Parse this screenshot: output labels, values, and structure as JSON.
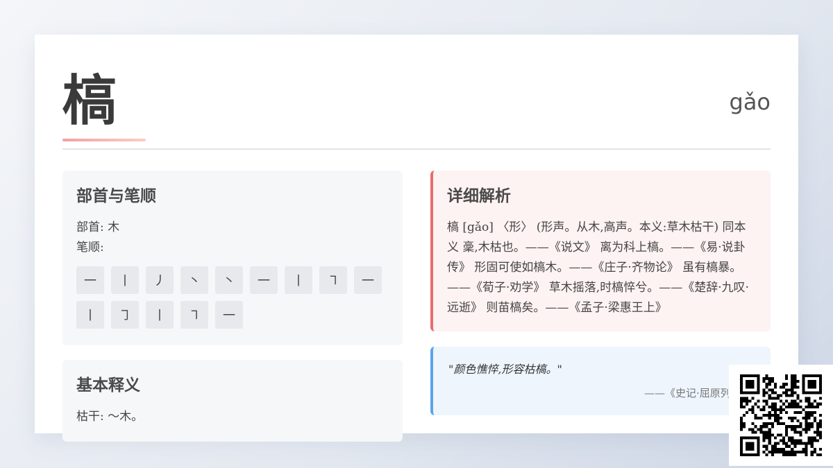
{
  "header": {
    "character": "槁",
    "pinyin": "gǎo"
  },
  "strokes_section": {
    "title": "部首与笔顺",
    "radical_label": "部首:",
    "radical_value": "木",
    "order_label": "笔顺:",
    "strokes": [
      "一",
      "丨",
      "丿",
      "丶",
      "丶",
      "一",
      "丨",
      "㇕",
      "一",
      "丨",
      "㇆",
      "丨",
      "㇕",
      "一"
    ]
  },
  "basic_section": {
    "title": "基本释义",
    "definition": "枯干: ～木。"
  },
  "detail_section": {
    "title": "详细解析",
    "text": "槁 [gǎo] 〈形〉 (形声。从木,高声。本义:草木枯干) 同本义 稾,木枯也。——《说文》 离为科上槁。——《易·说卦传》 形固可使如槁木。——《庄子·齐物论》 虽有槁暴。——《荀子·劝学》 草木摇落,时槁悴兮。——《楚辞·九叹·远逝》 则苗槁矣。——《孟子·梁惠王上》"
  },
  "quote_section": {
    "text": "\"颜色憔悴,形容枯槁。\"",
    "source": "——《史记·屈原列传》"
  },
  "qr_code": {
    "icon": "qr-code-icon"
  }
}
